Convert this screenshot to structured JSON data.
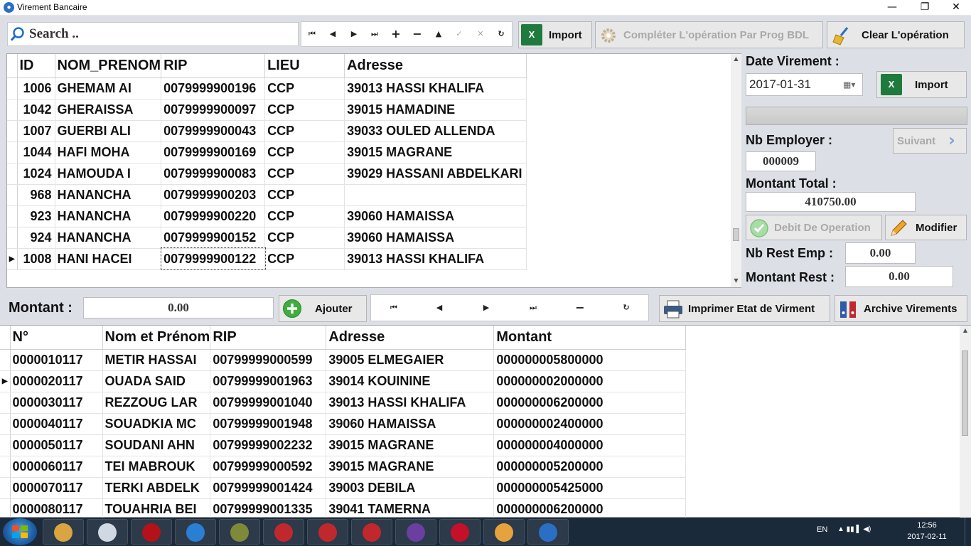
{
  "window": {
    "title": "Virement Bancaire",
    "minimize": "—",
    "maximize": "❐",
    "close": "✕"
  },
  "toolbar": {
    "search_placeholder": "Search ..",
    "nav_buttons": [
      "⏮",
      "◀",
      "▶",
      "⏭",
      "+",
      "−",
      "▲",
      "✓",
      "✕",
      "↻"
    ],
    "import_label": "Import",
    "complete_label": "Compléter L'opération Par Prog BDL",
    "clear_label": "Clear L'opération"
  },
  "top_grid": {
    "columns": [
      "ID",
      "NOM_PRENOM",
      "RIP",
      "LIEU",
      "Adresse"
    ],
    "rows": [
      {
        "id": "1006",
        "nom": "GHEMAM AI",
        "rip": "0079999900196",
        "lieu": "CCP",
        "adresse": "39013 HASSI KHALIFA"
      },
      {
        "id": "1042",
        "nom": "GHERAISSA",
        "rip": "0079999900097",
        "lieu": "CCP",
        "adresse": "39015 HAMADINE"
      },
      {
        "id": "1007",
        "nom": "GUERBI ALI",
        "rip": "0079999900043",
        "lieu": "CCP",
        "adresse": "39033 OULED ALLENDA"
      },
      {
        "id": "1044",
        "nom": "HAFI MOHA",
        "rip": "0079999900169",
        "lieu": "CCP",
        "adresse": "39015 MAGRANE"
      },
      {
        "id": "1024",
        "nom": "HAMOUDA I",
        "rip": "0079999900083",
        "lieu": "CCP",
        "adresse": "39029 HASSANI ABDELKARI"
      },
      {
        "id": "968",
        "nom": "HANANCHA",
        "rip": "0079999900203",
        "lieu": "CCP",
        "adresse": ""
      },
      {
        "id": "923",
        "nom": "HANANCHA",
        "rip": "0079999900220",
        "lieu": "CCP",
        "adresse": "39060 HAMAISSA"
      },
      {
        "id": "924",
        "nom": "HANANCHA",
        "rip": "0079999900152",
        "lieu": "CCP",
        "adresse": "39060 HAMAISSA"
      },
      {
        "id": "1008",
        "nom": "HANI HACEI",
        "rip": "0079999900122",
        "lieu": "CCP",
        "adresse": "39013 HASSI KHALIFA"
      }
    ],
    "current_row_marker": "▶"
  },
  "right_panel": {
    "date_label": "Date Virement :",
    "date_value": "2017-01-31",
    "import_label": "Import",
    "nb_employer_label": "Nb Employer :",
    "nb_employer_value": "000009",
    "suivant_label": "Suivant",
    "montant_total_label": "Montant Total :",
    "montant_total_value": "410750.00",
    "debit_label": "Debit De Operation",
    "modifier_label": "Modifier",
    "nb_rest_label": "Nb Rest Emp :",
    "nb_rest_value": "0.00",
    "montant_rest_label": "Montant Rest :",
    "montant_rest_value": "0.00"
  },
  "middle_bar": {
    "montant_label": "Montant :",
    "montant_value": "0.00",
    "ajouter_label": "Ajouter",
    "nav_buttons": [
      "⏮",
      "◀",
      "▶",
      "⏭",
      "−",
      "↻"
    ],
    "imprimer_label": "Imprimer Etat de Virment",
    "archive_label": "Archive Virements"
  },
  "bottom_grid": {
    "columns": [
      "N°",
      "Nom et Prénom",
      "RIP",
      "Adresse",
      "Montant"
    ],
    "rows": [
      {
        "n": "0000010117",
        "nom": "METIR HASSAI",
        "rip": "00799999000599",
        "adresse": "39005 ELMEGAIER",
        "montant": "000000005800000"
      },
      {
        "n": "0000020117",
        "nom": "OUADA SAID",
        "rip": "00799999001963",
        "adresse": "39014 KOUININE",
        "montant": "000000002000000"
      },
      {
        "n": "0000030117",
        "nom": "REZZOUG LAR",
        "rip": "00799999001040",
        "adresse": "39013 HASSI KHALIFA",
        "montant": "000000006200000"
      },
      {
        "n": "0000040117",
        "nom": "SOUADKIA MC",
        "rip": "00799999001948",
        "adresse": "39060 HAMAISSA",
        "montant": "000000002400000"
      },
      {
        "n": "0000050117",
        "nom": "SOUDANI AHN",
        "rip": "00799999002232",
        "adresse": "39015 MAGRANE",
        "montant": "000000004000000"
      },
      {
        "n": "0000060117",
        "nom": "TEI MABROUK",
        "rip": "00799999000592",
        "adresse": "39015 MAGRANE",
        "montant": "000000005200000"
      },
      {
        "n": "0000070117",
        "nom": "TERKI ABDELK",
        "rip": "00799999001424",
        "adresse": "39003 DEBILA",
        "montant": "000000005425000"
      },
      {
        "n": "0000080117",
        "nom": "TOUAHRIA BEI",
        "rip": "00799999001335",
        "adresse": "39041 TAMERNA",
        "montant": "000000006200000"
      }
    ],
    "current_row_marker": "▶"
  },
  "taskbar": {
    "apps": [
      "explorer",
      "paint-tool",
      "media-player",
      "internet-explorer",
      "tools",
      "bank-app",
      "bank-app-2",
      "rx-app",
      "visual-studio",
      "opera",
      "paint",
      "virement-app"
    ],
    "app_colors": [
      "#d9a441",
      "#cfd8e3",
      "#b3121a",
      "#2a7fd4",
      "#7e8a3a",
      "#c0282d",
      "#c0282d",
      "#c0282d",
      "#6a3fa0",
      "#c4102b",
      "#e6a23c",
      "#2b6fc4"
    ],
    "lang": "EN",
    "time": "12:56",
    "date": "2017-02-11"
  }
}
